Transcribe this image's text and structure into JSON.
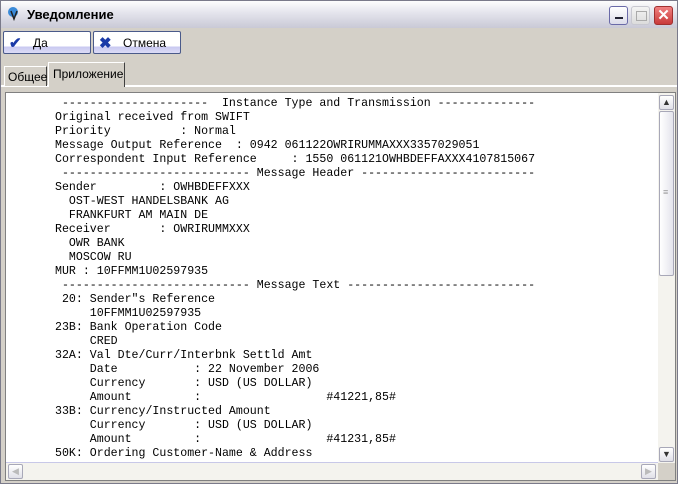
{
  "window": {
    "title": "Уведомление"
  },
  "toolbar": {
    "yes_label": "Да",
    "cancel_label": "Отмена"
  },
  "tabs": [
    {
      "label": "Общее"
    },
    {
      "label": "Приложение",
      "active": true
    }
  ],
  "message": {
    "lines": [
      " ---------------------  Instance Type and Transmission --------------",
      "Original received from SWIFT",
      "Priority          : Normal",
      "Message Output Reference  : 0942 061122OWRIRUMMAXXX3357029051",
      "Correspondent Input Reference     : 1550 061121OWHBDEFFAXXX4107815067",
      " --------------------------- Message Header -------------------------",
      "Sender         : OWHBDEFFXXX",
      "  OST-WEST HANDELSBANK AG",
      "  FRANKFURT AM MAIN DE",
      "Receiver       : OWRIRUMMXXX",
      "  OWR BANK",
      "  MOSCOW RU",
      "MUR : 10FFMM1U02597935",
      " --------------------------- Message Text ---------------------------",
      " 20: Sender\"s Reference",
      "     10FFMM1U02597935",
      "23B: Bank Operation Code",
      "     CRED",
      "32A: Val Dte/Curr/Interbnk Settld Amt",
      "     Date           : 22 November 2006",
      "     Currency       : USD (US DOLLAR)",
      "     Amount         :                  #41221,85#",
      "33B: Currency/Instructed Amount",
      "     Currency       : USD (US DOLLAR)",
      "     Amount         :                  #41231,85#",
      "50K: Ordering Customer-Name & Address"
    ]
  }
}
